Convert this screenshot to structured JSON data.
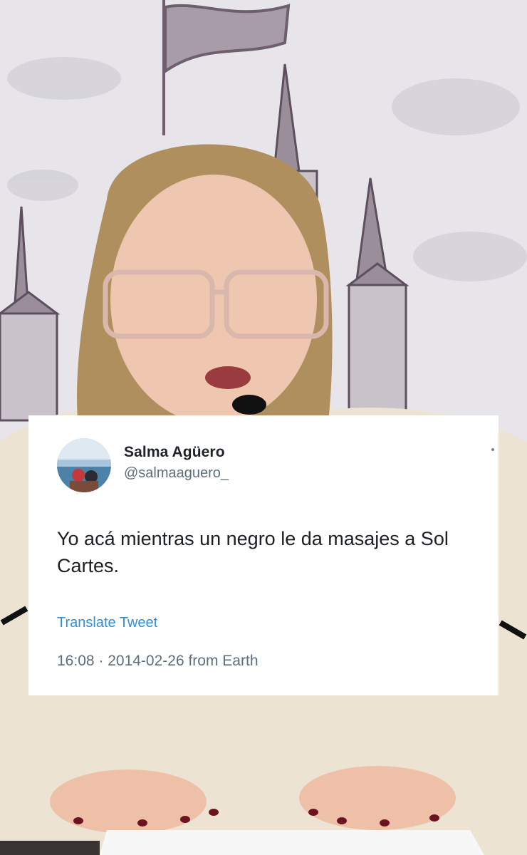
{
  "tweet": {
    "display_name": "Salma Agüero",
    "handle": "@salmaaguero_",
    "text": "Yo acá mientras un negro le da masajes a Sol Cartes.",
    "translate_label": "Translate Tweet",
    "timestamp": "16:08 · 2014-02-26 from Earth",
    "link_color": "#2f8fd8"
  },
  "background": {
    "backdrop_color": "#e6e4ea",
    "illustration_color": "#6e5f6e"
  }
}
